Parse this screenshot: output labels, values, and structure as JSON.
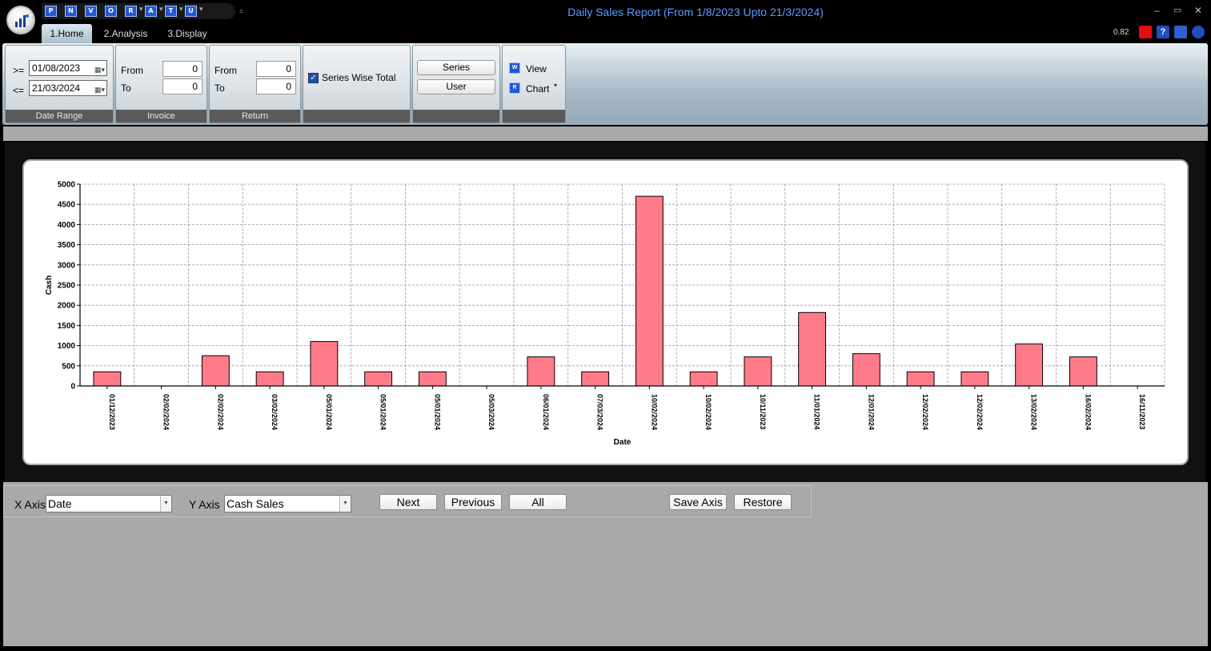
{
  "window": {
    "title": "Daily Sales Report (From 1/8/2023 Upto 21/3/2024)",
    "minimize": "–",
    "maximize": "▭",
    "close": "✕"
  },
  "quick_access": [
    {
      "glyph": "P"
    },
    {
      "glyph": "N"
    },
    {
      "glyph": "V"
    },
    {
      "glyph": "O"
    },
    {
      "glyph": "R"
    },
    {
      "glyph": "A"
    },
    {
      "glyph": "T"
    },
    {
      "glyph": "U"
    }
  ],
  "tabs": [
    {
      "label": "1.Home",
      "active": true
    },
    {
      "label": "2.Analysis",
      "active": false
    },
    {
      "label": "3.Display",
      "active": false
    }
  ],
  "zoom_readout": "0.82",
  "ribbon": {
    "date_range": {
      "label": "Date Range",
      "from_op": ">=",
      "to_op": "<=",
      "from_value": "01/08/2023",
      "to_value": "21/03/2024"
    },
    "invoice": {
      "label": "Invoice",
      "from_label": "From",
      "to_label": "To",
      "from_value": "0",
      "to_value": "0"
    },
    "return": {
      "label": "Return",
      "from_label": "From",
      "to_label": "To",
      "from_value": "0",
      "to_value": "0"
    },
    "options": {
      "series_wise_total_label": "Series Wise Total",
      "series_wise_total_checked": true
    },
    "group_buttons": {
      "series_label": "Series",
      "user_label": "User"
    },
    "view_group": {
      "view_label": "View",
      "chart_label": "Chart"
    }
  },
  "chart_data": {
    "type": "bar",
    "xlabel": "Date",
    "ylabel": "Cash",
    "ylim": [
      0,
      5000
    ],
    "yticks": [
      0,
      500,
      1000,
      1500,
      2000,
      2500,
      3000,
      3500,
      4000,
      4500,
      5000
    ],
    "grid": true,
    "bar_color": "#ff7b8a",
    "categories": [
      "01/12/2023",
      "02/02/2024",
      "02/02/2024",
      "03/02/2024",
      "05/01/2024",
      "05/01/2024",
      "05/01/2024",
      "05/03/2024",
      "06/01/2024",
      "07/03/2024",
      "10/02/2024",
      "10/02/2024",
      "10/11/2023",
      "11/01/2024",
      "12/01/2024",
      "12/02/2024",
      "12/02/2024",
      "13/02/2024",
      "16/02/2024",
      "16/11/2023"
    ],
    "values": [
      350,
      0,
      750,
      350,
      1100,
      350,
      350,
      0,
      720,
      350,
      4700,
      350,
      720,
      1820,
      800,
      350,
      350,
      1040,
      720,
      0
    ]
  },
  "controls": {
    "x_axis_label": "X Axis",
    "x_axis_value": "Date",
    "y_axis_label": "Y Axis",
    "y_axis_value": "Cash Sales",
    "next_label": "Next",
    "previous_label": "Previous",
    "all_label": "All",
    "save_axis_label": "Save Axis",
    "restore_label": "Restore"
  }
}
